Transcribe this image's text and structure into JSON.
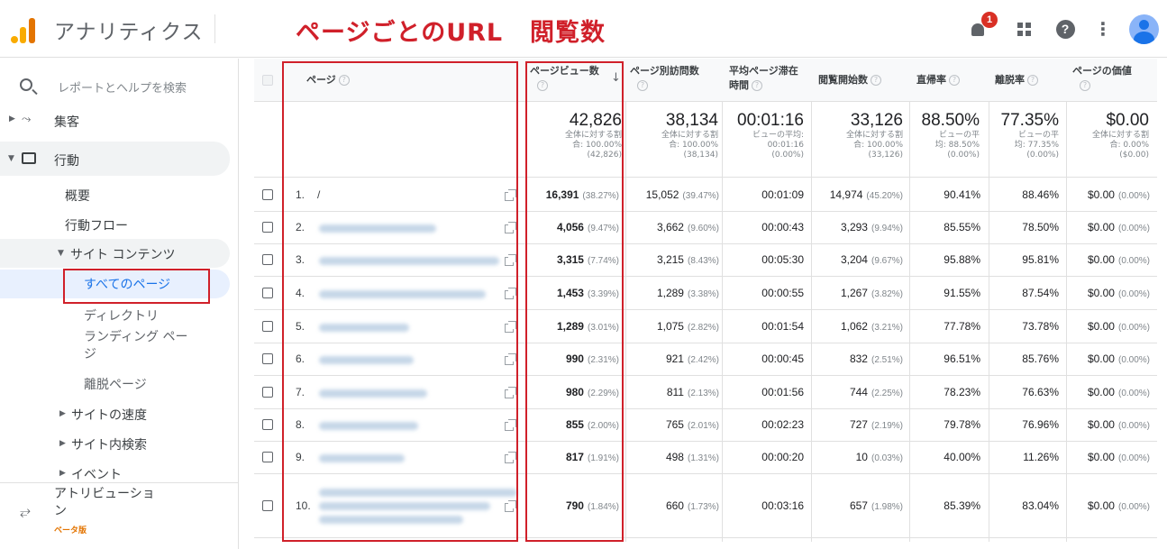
{
  "header": {
    "app_title": "アナリティクス",
    "annotation_url": "ページごとのURL",
    "annotation_views": "閲覧数",
    "notification_count": "1",
    "help_glyph": "?",
    "more_glyph": "⋮"
  },
  "sidebar": {
    "search_label": "レポートとヘルプを検索",
    "acquisition": "集客",
    "behavior": "行動",
    "overview": "概要",
    "behavior_flow": "行動フロー",
    "site_content": "サイト コンテンツ",
    "all_pages": "すべてのページ",
    "directory": "ディレクトリ",
    "landing_line1": "ランディング ペー",
    "landing_line2": "ジ",
    "exit_pages": "離脱ページ",
    "site_speed": "サイトの速度",
    "site_search": "サイト内検索",
    "events": "イベント",
    "attribution_line1": "アトリビューショ",
    "attribution_line2": "ン",
    "beta": "ベータ版"
  },
  "table": {
    "headers": {
      "page": "ページ",
      "pageviews": "ページビュー数",
      "unique": "ページ別訪問数",
      "avg_time_line1": "平均ページ滞在",
      "avg_time_line2": "時間",
      "entrances": "閲覧開始数",
      "bounce": "直帰率",
      "exit": "離脱率",
      "value": "ページの価値"
    },
    "summary": {
      "pageviews": {
        "big": "42,826",
        "l1": "全体に対する割",
        "l2": "合: 100.00%",
        "l3": "(42,826)"
      },
      "unique": {
        "big": "38,134",
        "l1": "全体に対する割",
        "l2": "合: 100.00%",
        "l3": "(38,134)"
      },
      "avg_time": {
        "big": "00:01:16",
        "l1": "ビューの平均:",
        "l2": "00:01:16",
        "l3": "(0.00%)"
      },
      "entrances": {
        "big": "33,126",
        "l1": "全体に対する割",
        "l2": "合: 100.00%",
        "l3": "(33,126)"
      },
      "bounce": {
        "big": "88.50%",
        "l1": "ビューの平",
        "l2": "均: 88.50%",
        "l3": "(0.00%)"
      },
      "exit": {
        "big": "77.35%",
        "l1": "ビューの平",
        "l2": "均: 77.35%",
        "l3": "(0.00%)"
      },
      "value": {
        "big": "$0.00",
        "l1": "全体に対する割",
        "l2": "合: 0.00%",
        "l3": "($0.00)"
      }
    },
    "rows": [
      {
        "num": "1.",
        "page": "/",
        "pv": "16,391",
        "pv_pct": "(38.27%)",
        "uv": "15,052",
        "uv_pct": "(39.47%)",
        "time": "00:01:09",
        "ent": "14,974",
        "ent_pct": "(45.20%)",
        "bounce": "90.41%",
        "exit": "88.46%",
        "val": "$0.00",
        "val_pct": "(0.00%)"
      },
      {
        "num": "2.",
        "page": "",
        "pv": "4,056",
        "pv_pct": "(9.47%)",
        "uv": "3,662",
        "uv_pct": "(9.60%)",
        "time": "00:00:43",
        "ent": "3,293",
        "ent_pct": "(9.94%)",
        "bounce": "85.55%",
        "exit": "78.50%",
        "val": "$0.00",
        "val_pct": "(0.00%)"
      },
      {
        "num": "3.",
        "page": "",
        "pv": "3,315",
        "pv_pct": "(7.74%)",
        "uv": "3,215",
        "uv_pct": "(8.43%)",
        "time": "00:05:30",
        "ent": "3,204",
        "ent_pct": "(9.67%)",
        "bounce": "95.88%",
        "exit": "95.81%",
        "val": "$0.00",
        "val_pct": "(0.00%)"
      },
      {
        "num": "4.",
        "page": "",
        "pv": "1,453",
        "pv_pct": "(3.39%)",
        "uv": "1,289",
        "uv_pct": "(3.38%)",
        "time": "00:00:55",
        "ent": "1,267",
        "ent_pct": "(3.82%)",
        "bounce": "91.55%",
        "exit": "87.54%",
        "val": "$0.00",
        "val_pct": "(0.00%)"
      },
      {
        "num": "5.",
        "page": "",
        "pv": "1,289",
        "pv_pct": "(3.01%)",
        "uv": "1,075",
        "uv_pct": "(2.82%)",
        "time": "00:01:54",
        "ent": "1,062",
        "ent_pct": "(3.21%)",
        "bounce": "77.78%",
        "exit": "73.78%",
        "val": "$0.00",
        "val_pct": "(0.00%)"
      },
      {
        "num": "6.",
        "page": "",
        "pv": "990",
        "pv_pct": "(2.31%)",
        "uv": "921",
        "uv_pct": "(2.42%)",
        "time": "00:00:45",
        "ent": "832",
        "ent_pct": "(2.51%)",
        "bounce": "96.51%",
        "exit": "85.76%",
        "val": "$0.00",
        "val_pct": "(0.00%)"
      },
      {
        "num": "7.",
        "page": "",
        "pv": "980",
        "pv_pct": "(2.29%)",
        "uv": "811",
        "uv_pct": "(2.13%)",
        "time": "00:01:56",
        "ent": "744",
        "ent_pct": "(2.25%)",
        "bounce": "78.23%",
        "exit": "76.63%",
        "val": "$0.00",
        "val_pct": "(0.00%)"
      },
      {
        "num": "8.",
        "page": "",
        "pv": "855",
        "pv_pct": "(2.00%)",
        "uv": "765",
        "uv_pct": "(2.01%)",
        "time": "00:02:23",
        "ent": "727",
        "ent_pct": "(2.19%)",
        "bounce": "79.78%",
        "exit": "76.96%",
        "val": "$0.00",
        "val_pct": "(0.00%)"
      },
      {
        "num": "9.",
        "page": "",
        "pv": "817",
        "pv_pct": "(1.91%)",
        "uv": "498",
        "uv_pct": "(1.31%)",
        "time": "00:00:20",
        "ent": "10",
        "ent_pct": "(0.03%)",
        "bounce": "40.00%",
        "exit": "11.26%",
        "val": "$0.00",
        "val_pct": "(0.00%)"
      },
      {
        "num": "10.",
        "page": "",
        "pv": "790",
        "pv_pct": "(1.84%)",
        "uv": "660",
        "uv_pct": "(1.73%)",
        "time": "00:03:16",
        "ent": "657",
        "ent_pct": "(1.98%)",
        "bounce": "85.39%",
        "exit": "83.04%",
        "val": "$0.00",
        "val_pct": "(0.00%)"
      }
    ]
  },
  "colors": {
    "annotation_red": "#d0202a",
    "accent_blue": "#1a73e8",
    "logo_orange": "#f9ab00",
    "logo_dark_orange": "#e37400"
  }
}
